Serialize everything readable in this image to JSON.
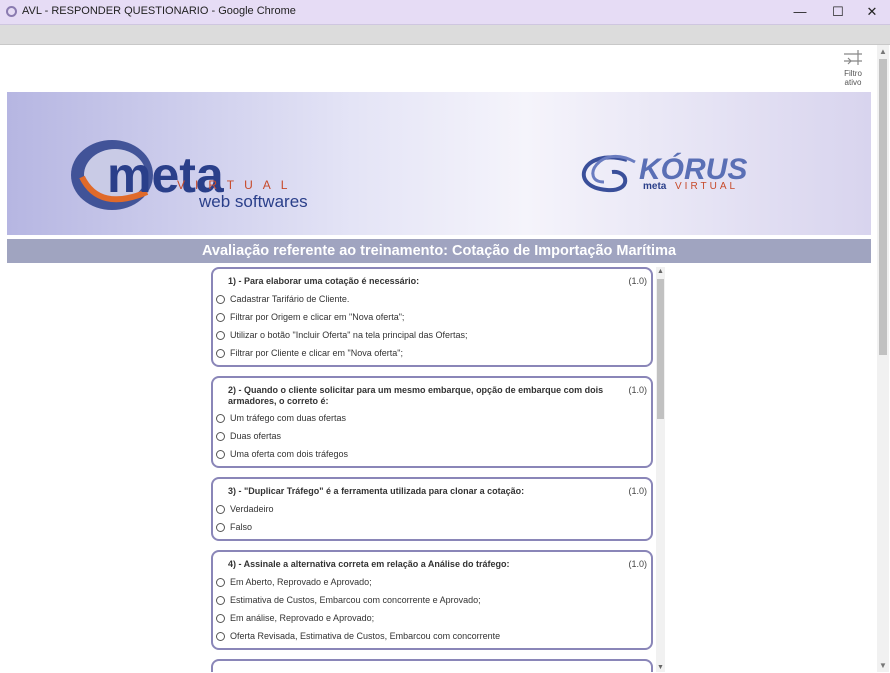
{
  "window": {
    "title": "AVL - RESPONDER QUESTIONARIO - Google Chrome"
  },
  "filter": {
    "line1": "Filtro",
    "line2": "ativo"
  },
  "banner": {
    "left_logo": {
      "word": "meta",
      "sub": "VIRTUAL",
      "tagline": "web softwares"
    },
    "right_logo": {
      "word": "KÓRUS",
      "sub_a": "meta",
      "sub_b": "VIRTUAL"
    }
  },
  "heading": "Avaliação referente ao treinamento: Cotação de Importação Marítima",
  "questions": [
    {
      "text": "1) - Para elaborar uma cotação é necessário:",
      "score": "(1.0)",
      "options": [
        "Cadastrar Tarifário de Cliente.",
        "Filtrar por Origem e clicar em \"Nova oferta\";",
        "Utilizar o botão \"Incluir Oferta\" na tela principal das Ofertas;",
        "Filtrar por Cliente e clicar em \"Nova oferta\";"
      ]
    },
    {
      "text": "2) - Quando o cliente solicitar para um mesmo embarque, opção de embarque com dois armadores, o correto é:",
      "score": "(1.0)",
      "options": [
        "Um tráfego com duas ofertas",
        "Duas ofertas",
        "Uma oferta com dois tráfegos"
      ]
    },
    {
      "text": "3) - \"Duplicar Tráfego\" é a ferramenta utilizada para clonar a cotação:",
      "score": "(1.0)",
      "options": [
        "Verdadeiro",
        "Falso"
      ]
    },
    {
      "text": "4) - Assinale a alternativa correta em relação a Análise do tráfego:",
      "score": "(1.0)",
      "options": [
        "Em Aberto, Reprovado e Aprovado;",
        "Estimativa de Custos, Embarcou com concorrente e Aprovado;",
        "Em análise, Reprovado e Aprovado;",
        "Oferta Revisada, Estimativa de Custos, Embarcou com concorrente"
      ]
    }
  ]
}
